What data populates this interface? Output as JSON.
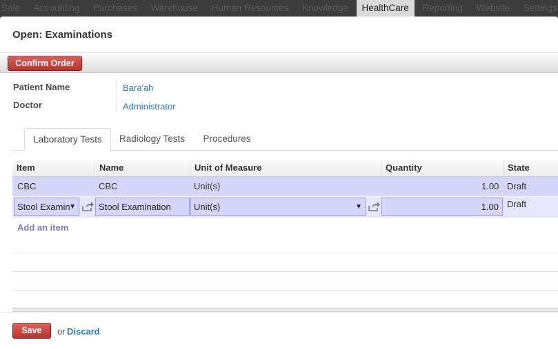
{
  "menu": [
    "Sale",
    "Accounting",
    "Purchases",
    "Warehouse",
    "Human Resources",
    "Knowledge",
    "HealthCare",
    "Reporting",
    "Website",
    "Settings"
  ],
  "menu_active": "HealthCare",
  "dialog": {
    "title": "Open: Examinations",
    "confirm_label": "Confirm Order"
  },
  "form": {
    "patient_label": "Patient Name",
    "patient_value": "Bara'ah",
    "doctor_label": "Doctor",
    "doctor_value": "Administrator"
  },
  "tabs": [
    "Laboratory Tests",
    "Radiology Tests",
    "Procedures"
  ],
  "active_tab": "Laboratory Tests",
  "table": {
    "headers": [
      "Item",
      "Name",
      "Unit of Measure",
      "Quantity",
      "State"
    ],
    "rows": [
      {
        "item": "CBC",
        "name": "CBC",
        "uom": "Unit(s)",
        "quantity": "1.00",
        "state": "Draft"
      },
      {
        "item": "Stool Examin",
        "name": "Stool Examination",
        "uom": "Unit(s)",
        "quantity": "1.00",
        "state": "Draft"
      }
    ],
    "add_item_label": "Add an item"
  },
  "footer": {
    "save_label": "Save",
    "or_label": "or",
    "discard_label": "Discard"
  },
  "icons": {
    "dropdown": "caret-down-icon",
    "external": "share-icon"
  },
  "colors": {
    "row_selected": "#d6d6fb",
    "row_editing": "#e6e6ff",
    "link": "#2b7bb9",
    "primary_button": "#c43d37"
  }
}
